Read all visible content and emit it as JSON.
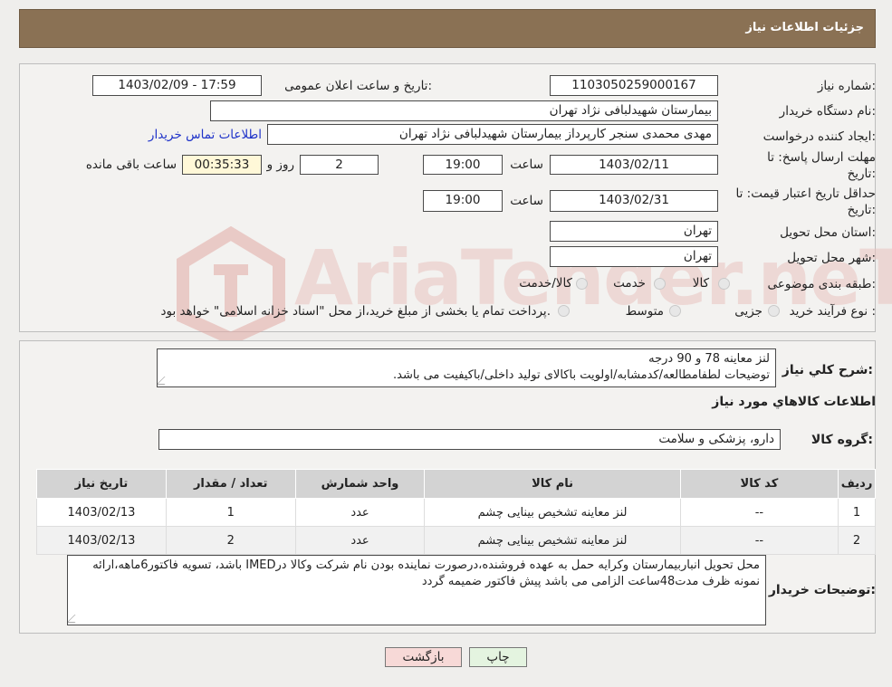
{
  "header": {
    "title": "جزئیات اطلاعات نیاز"
  },
  "watermark": {
    "text": "AriaTender.neT"
  },
  "form": {
    "need_number_label": "شماره نیاز:",
    "need_number": "1103050259000167",
    "announce_label": "تاریخ و ساعت اعلان عمومی:",
    "announce_value": "1403/02/09 - 17:59",
    "buyer_org_label": "نام دستگاه خریدار:",
    "buyer_org": "بیمارستان شهیدلبافی نژاد تهران",
    "creator_label": "ایجاد کننده درخواست:",
    "creator": "مهدی محمدی سنجر کارپرداز بیمارستان شهیدلبافی نژاد تهران",
    "contact_link": "اطلاعات تماس خریدار",
    "deadline_label_1": "مهلت ارسال پاسخ: تا",
    "deadline_label_2": "تاریخ:",
    "deadline_date": "1403/02/11",
    "time_label": "ساعت",
    "deadline_time": "19:00",
    "days_value": "2",
    "days_label": "روز و",
    "remaining_time": "00:35:33",
    "remaining_label": "ساعت باقی مانده",
    "validity_label_1": "حداقل تاریخ اعتبار قیمت: تا",
    "validity_label_2": "تاریخ:",
    "validity_date": "1403/02/31",
    "validity_time": "19:00",
    "province_label": "استان محل تحویل:",
    "province": "تهران",
    "city_label": "شهر محل تحویل:",
    "city": "تهران",
    "category_label": "طبقه بندی موضوعی:",
    "category_options": [
      "کالا",
      "خدمت",
      "کالا/خدمت"
    ],
    "purchase_type_label": "نوع فرآیند خرید :",
    "purchase_options": [
      "جزیی",
      "متوسط"
    ],
    "purchase_note": "پرداخت تمام یا بخشی از مبلغ خرید،از محل \"اسناد خزانه اسلامی\" خواهد بود."
  },
  "summary": {
    "label": "شرح کلي نياز:",
    "line1": "لنز معاینه 78 و 90 درجه",
    "line2": "توضیحات لطفامطالعه/کدمشابه/اولویت باکالای تولید داخلی/باکیفیت می باشد."
  },
  "goods": {
    "section_title": "اطلاعات کالاهاي مورد نياز",
    "group_label": "گروه کالا:",
    "group_value": "دارو، پزشکی و سلامت",
    "columns": [
      "رديف",
      "کد کالا",
      "نام کالا",
      "واحد شمارش",
      "تعداد / مقدار",
      "تاريخ نياز"
    ],
    "rows": [
      {
        "index": "1",
        "code": "--",
        "name": "لنز معاینه تشخیص بینایی چشم",
        "unit": "عدد",
        "qty": "1",
        "date": "1403/02/13"
      },
      {
        "index": "2",
        "code": "--",
        "name": "لنز معاینه تشخیص بینایی چشم",
        "unit": "عدد",
        "qty": "2",
        "date": "1403/02/13"
      }
    ]
  },
  "buyer_notes": {
    "label": "توضيحات خريدار:",
    "text": "محل تحویل انباربیمارستان وکرایه حمل به عهده فروشنده،درصورت نماینده بودن نام شرکت وکالا درIMED باشد، تسویه فاکتور6ماهه،ارائه نمونه ظرف مدت48ساعت الزامی می باشد پیش فاکتور ضمیمه گردد"
  },
  "buttons": {
    "print": "چاپ",
    "back": "بازگشت"
  }
}
